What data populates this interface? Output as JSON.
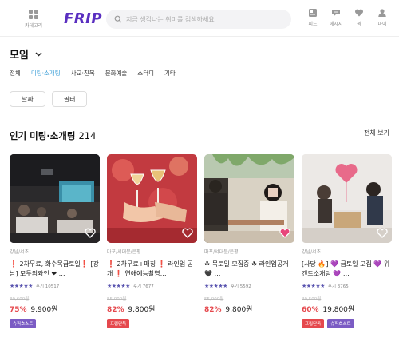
{
  "header": {
    "category_label": "카테고리",
    "logo": "FRIP",
    "search_placeholder": "지금 생각나는 취미를 검색하세요",
    "icons": [
      {
        "name": "feed-icon",
        "label": "피드"
      },
      {
        "name": "message-icon",
        "label": "메시지"
      },
      {
        "name": "heart-icon",
        "label": "찜"
      },
      {
        "name": "user-icon",
        "label": "마이"
      }
    ]
  },
  "page": {
    "title": "모임"
  },
  "subnav": {
    "items": [
      "전체",
      "미팅·소개팅",
      "사교·친목",
      "문화예술",
      "스터디",
      "기타"
    ],
    "active_index": 1
  },
  "filters": [
    "날짜",
    "필터"
  ],
  "section": {
    "title": "인기 미팅·소개팅",
    "count": "214",
    "see_all": "전체 보기"
  },
  "cards": [
    {
      "location": "강남/서초",
      "title": "❗ 2차무료, 화수목금토일❗ [강남] 모두의와인 ❤ …",
      "stars": "★★★★★",
      "reviews": "후기 10517",
      "original_price": "39,600원",
      "discount": "75%",
      "price": "9,900원",
      "badges": [
        {
          "text": "슈퍼호스트",
          "color": "#7b5cc4"
        }
      ]
    },
    {
      "location": "마포/서대문/은평",
      "title": "❗ 2차무료+매칭 ❗ 라인업 공개 ❗ 연애예능촬영…",
      "stars": "★★★★★",
      "reviews": "후기 7677",
      "original_price": "55,000원",
      "discount": "82%",
      "price": "9,800원",
      "badges": [
        {
          "text": "프립단독",
          "color": "#e5484d"
        }
      ]
    },
    {
      "location": "마포/서대문/은평",
      "title": "☘ 목토일 모집중 ☘ 라인업공개 🖤 …",
      "stars": "★★★★★",
      "reviews": "후기 5592",
      "original_price": "55,000원",
      "discount": "82%",
      "price": "9,800원",
      "badges": []
    },
    {
      "location": "강남/서초",
      "title": "[사당 🔥] 💜 금토일 모집 💜 위켄드소개팅 💜 …",
      "stars": "★★★★★",
      "reviews": "후기 3765",
      "original_price": "49,500원",
      "discount": "60%",
      "price": "19,800원",
      "badges": [
        {
          "text": "프립단독",
          "color": "#e5484d"
        },
        {
          "text": "슈퍼호스트",
          "color": "#7b5cc4"
        }
      ]
    }
  ]
}
